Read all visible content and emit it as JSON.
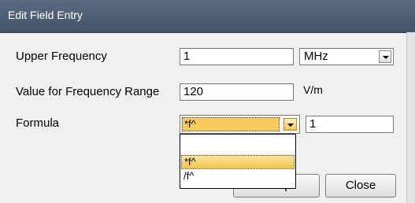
{
  "window": {
    "title": "Edit Field Entry"
  },
  "fields": {
    "upper_frequency": {
      "label": "Upper Frequency",
      "value": "1",
      "unit_selected": "MHz"
    },
    "value_for_range": {
      "label": "Value for Frequency Range",
      "value": "120",
      "unit": "V/m"
    },
    "formula": {
      "label": "Formula",
      "operator_selected": "*f^",
      "exponent_value": "1"
    }
  },
  "dropdown": {
    "options": [
      "",
      "*f^",
      "/f^"
    ],
    "highlighted_index": 1
  },
  "buttons": {
    "accept": "Accept",
    "close": "Close"
  },
  "icons": {
    "combo_arrow": "chevron-down-icon"
  },
  "colors": {
    "highlight": "#f7cc5b",
    "titlebar": "#4f5e72"
  }
}
